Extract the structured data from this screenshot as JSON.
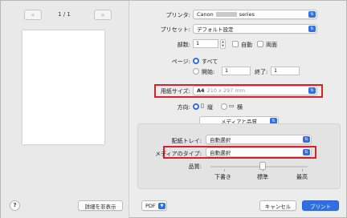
{
  "window": {
    "title": ""
  },
  "preview": {
    "page_count": "1 / 1",
    "prev_icon": "double-chevron-left-icon",
    "next_icon": "double-chevron-right-icon"
  },
  "printer": {
    "label": "プリンタ:",
    "value": "Canon",
    "suffix": "series"
  },
  "preset": {
    "label": "プリセット:",
    "value": "デフォルト設定"
  },
  "copies": {
    "label": "部数:",
    "value": "1",
    "collate_label": "自動",
    "duplex_label": "両面"
  },
  "pages": {
    "label": "ページ:",
    "all_label": "すべて",
    "from_label": "開始:",
    "from_value": "1",
    "to_label": "終了:",
    "to_value": "1"
  },
  "paper": {
    "label": "用紙サイズ:",
    "value": "A4",
    "dims": "210 x 297 mm"
  },
  "orientation": {
    "label": "方向:",
    "portrait_label": "縦",
    "landscape_label": "横"
  },
  "panel_menu": {
    "value": "メディアと品質"
  },
  "tray": {
    "label": "配紙トレイ:",
    "value": "自動選択"
  },
  "media_type": {
    "label": "メディアのタイプ:",
    "value": "自動選択"
  },
  "quality": {
    "label": "品質:",
    "low": "下書き",
    "standard": "標準",
    "high": "最高",
    "value": "標準"
  },
  "buttons": {
    "help": "?",
    "details": "詳細を非表示",
    "pdf": "PDF",
    "cancel": "キャンセル",
    "print": "プリント"
  },
  "colors": {
    "accent": "#2f6fe0",
    "highlight": "#d8222b"
  }
}
